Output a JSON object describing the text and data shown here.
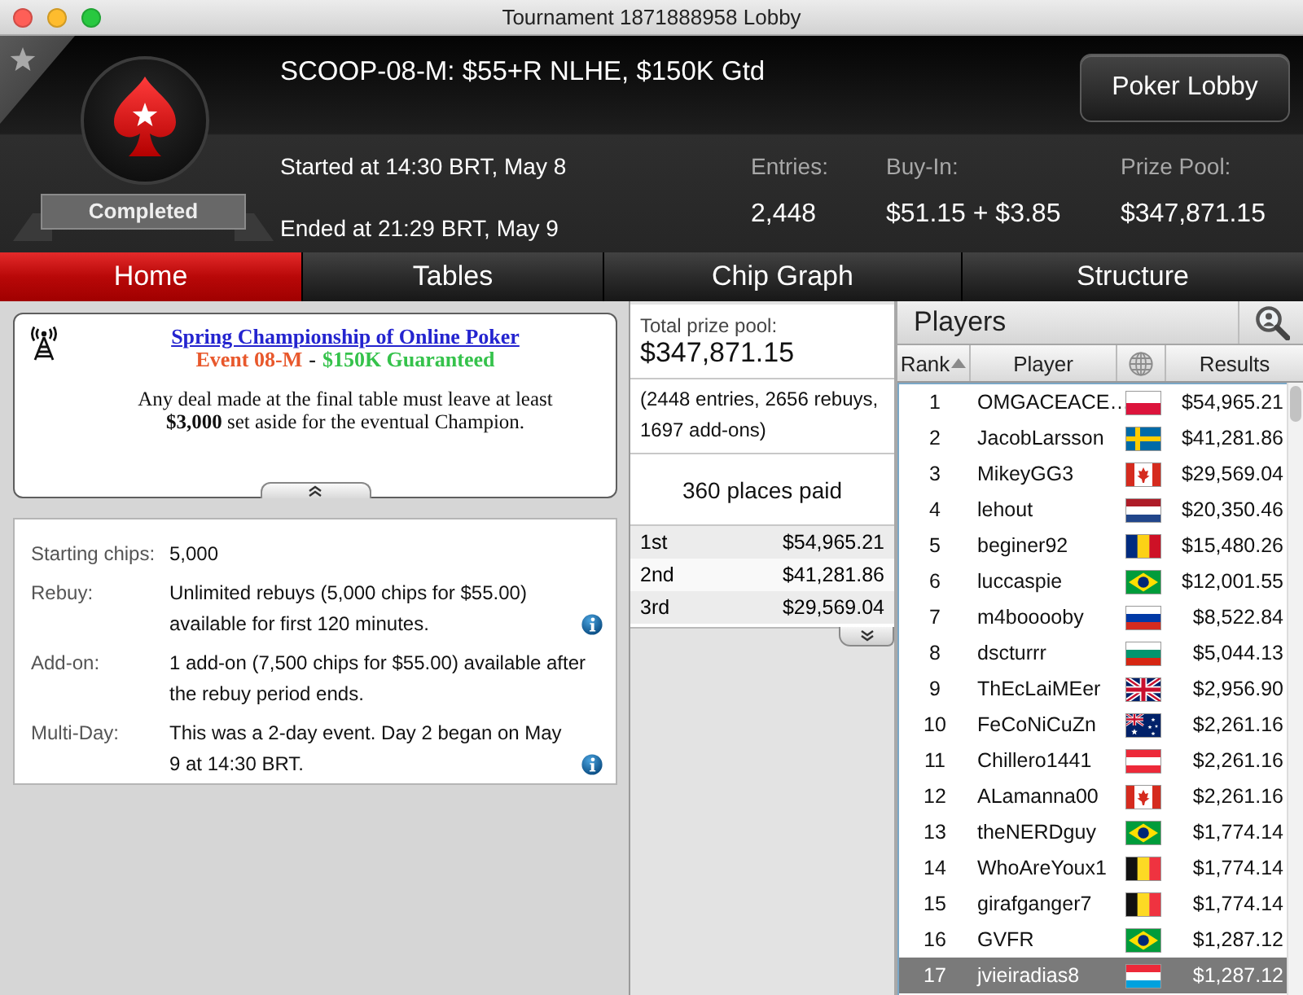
{
  "window": {
    "title": "Tournament 1871888958 Lobby"
  },
  "header": {
    "title": "SCOOP-08-M: $55+R NLHE, $150K Gtd",
    "status": "Completed",
    "button": "Poker Lobby",
    "started": "Started at 14:30 BRT, May 8",
    "ended": "Ended at 21:29 BRT, May 9",
    "stats": [
      {
        "label": "Entries:",
        "value": "2,448"
      },
      {
        "label": "Buy-In:",
        "value": "$51.15 + $3.85"
      },
      {
        "label": "Prize Pool:",
        "value": "$347,871.15"
      }
    ]
  },
  "tabs": [
    {
      "label": "Home",
      "selected": true
    },
    {
      "label": "Tables",
      "selected": false
    },
    {
      "label": "Chip Graph",
      "selected": false
    },
    {
      "label": "Structure",
      "selected": false
    }
  ],
  "news": {
    "link": "Spring Championship of Online Poker",
    "subtitle": [
      {
        "text": "Event 08-M",
        "color": "#e8582c"
      },
      {
        "text": "-",
        "color": "#222222"
      },
      {
        "text": "$150K Guaranteed",
        "color": "#35c24b"
      }
    ],
    "text": "Any deal made at the final table must leave at least **$3,000** set aside for the eventual Champion."
  },
  "details": [
    {
      "label": "Starting chips:",
      "value": "5,000",
      "info": false
    },
    {
      "label": "Rebuy:",
      "value": "Unlimited rebuys (5,000 chips for $55.00) available for first 120 minutes.",
      "info": true
    },
    {
      "label": "Add-on:",
      "value": "1 add-on (7,500 chips for $55.00) available after the rebuy period ends.",
      "info": false
    },
    {
      "label": "Multi-Day:",
      "value": "This was a 2-day event. Day 2 began on May 9 at 14:30 BRT.",
      "info": true
    }
  ],
  "prizes": {
    "label": "Total prize pool:",
    "total": "$347,871.15",
    "breakdown": "(2448 entries, 2656 rebuys, 1697 add-ons)",
    "places": "360 places paid",
    "payouts": [
      {
        "place": "1st",
        "amount": "$54,965.21"
      },
      {
        "place": "2nd",
        "amount": "$41,281.86"
      },
      {
        "place": "3rd",
        "amount": "$29,569.04"
      }
    ]
  },
  "players": {
    "title": "Players",
    "columns": [
      {
        "kind": "text",
        "label": "Rank",
        "sorted": true
      },
      {
        "kind": "text",
        "label": "Player",
        "sorted": false
      },
      {
        "kind": "globe"
      },
      {
        "kind": "text",
        "label": "Results",
        "sorted": false
      }
    ],
    "rows": [
      {
        "rank": "1",
        "player": "OMGACEACE…",
        "kind": "poland",
        "result": "$54,965.21",
        "selected": false
      },
      {
        "rank": "2",
        "player": "JacobLarsson",
        "kind": "sweden",
        "result": "$41,281.86",
        "selected": false
      },
      {
        "rank": "3",
        "player": "MikeyGG3",
        "kind": "canada",
        "result": "$29,569.04",
        "selected": false
      },
      {
        "rank": "4",
        "player": "lehout",
        "kind": "netherlands",
        "result": "$20,350.46",
        "selected": false
      },
      {
        "rank": "5",
        "player": "beginer92",
        "kind": "romania",
        "result": "$15,480.26",
        "selected": false
      },
      {
        "rank": "6",
        "player": "luccaspie",
        "kind": "brazil",
        "result": "$12,001.55",
        "selected": false
      },
      {
        "rank": "7",
        "player": "m4booooby",
        "kind": "russia",
        "result": "$8,522.84",
        "selected": false
      },
      {
        "rank": "8",
        "player": "dscturrr",
        "kind": "bulgaria",
        "result": "$5,044.13",
        "selected": false
      },
      {
        "rank": "9",
        "player": "ThEcLaiMEer",
        "kind": "uk",
        "result": "$2,956.90",
        "selected": false
      },
      {
        "rank": "10",
        "player": "FeCoNiCuZn",
        "kind": "australia",
        "result": "$2,261.16",
        "selected": false
      },
      {
        "rank": "11",
        "player": "Chillero1441",
        "kind": "austria",
        "result": "$2,261.16",
        "selected": false
      },
      {
        "rank": "12",
        "player": "ALamanna00",
        "kind": "canada",
        "result": "$2,261.16",
        "selected": false
      },
      {
        "rank": "13",
        "player": "theNERDguy",
        "kind": "brazil",
        "result": "$1,774.14",
        "selected": false
      },
      {
        "rank": "14",
        "player": "WhoAreYoux1",
        "kind": "belgium",
        "result": "$1,774.14",
        "selected": false
      },
      {
        "rank": "15",
        "player": "girafganger7",
        "kind": "belgium",
        "result": "$1,774.14",
        "selected": false
      },
      {
        "rank": "16",
        "player": "GVFR",
        "kind": "brazil",
        "result": "$1,287.12",
        "selected": false
      },
      {
        "rank": "17",
        "player": "jvieiradias8",
        "kind": "luxembourg",
        "result": "$1,287.12",
        "selected": true
      }
    ]
  }
}
